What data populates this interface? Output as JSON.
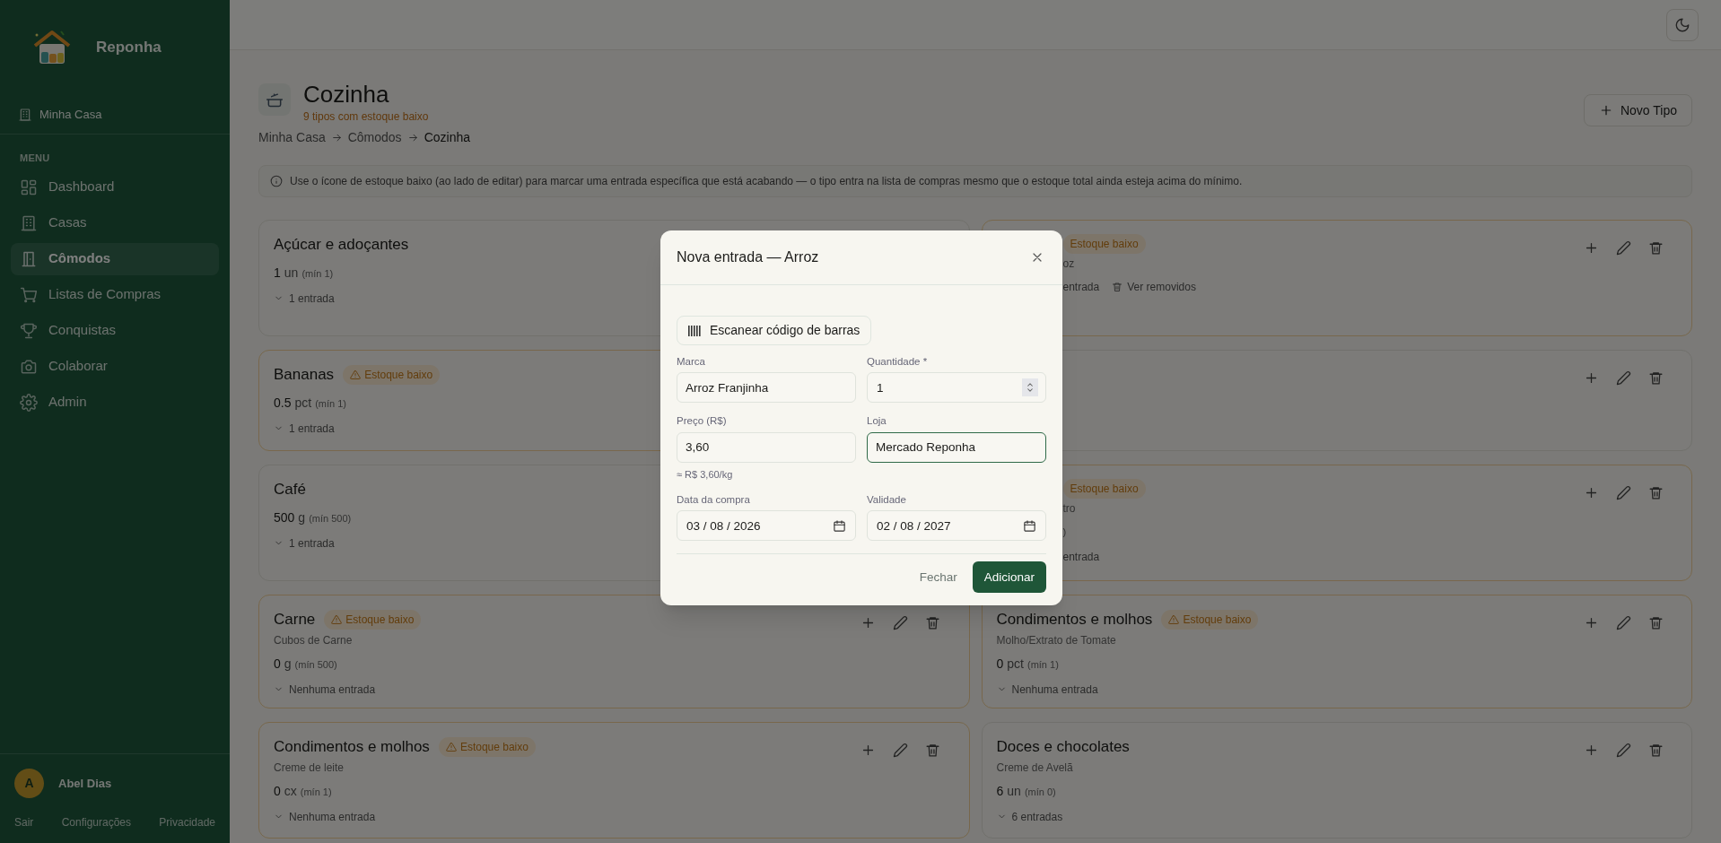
{
  "sidebar": {
    "brand": "Reponha",
    "house": "Minha Casa",
    "section": "MENU",
    "items": [
      {
        "label": "Dashboard",
        "selected": false
      },
      {
        "label": "Casas",
        "selected": false
      },
      {
        "label": "Cômodos",
        "selected": true
      },
      {
        "label": "Listas de Compras",
        "selected": false
      },
      {
        "label": "Conquistas",
        "selected": false
      },
      {
        "label": "Colaborar",
        "selected": false
      },
      {
        "label": "Admin",
        "selected": false
      }
    ],
    "user": {
      "initial": "A",
      "name": "Abel Dias"
    },
    "footer_links": [
      "Sair",
      "Configurações",
      "Privacidade"
    ]
  },
  "page": {
    "title": "Cozinha",
    "subtitle": "9 tipos com estoque baixo",
    "breadcrumb": [
      "Minha Casa",
      "Cômodos",
      "Cozinha"
    ],
    "new_button": "Novo Tipo",
    "notice": "Use o ícone de estoque baixo (ao lado de editar) para marcar uma entrada específica que está acabando — o tipo entra na lista de compras mesmo que o estoque total ainda esteja acima do mínimo."
  },
  "cards": [
    {
      "kind": "covered_right",
      "name": "Açúcar e adoçantes",
      "low_stock": false,
      "amount": "1",
      "unit": "un",
      "min": "(mín 1)",
      "entries": "1 entrada"
    },
    {
      "kind": "covered_left",
      "low_stock": true,
      "badge": "Estoque baixo",
      "subtitle": "oz",
      "entries": "entrada",
      "removed_link": "Ver removidos"
    },
    {
      "kind": "covered_right",
      "name": "Bananas",
      "low_stock": true,
      "badge": "Estoque baixo",
      "amount": "0.5",
      "unit": "pct",
      "min": "(mín 1)",
      "entries": "1 entrada"
    },
    {
      "kind": "covered_left",
      "low_stock": false
    },
    {
      "kind": "covered_right",
      "name": "Café",
      "low_stock": false,
      "amount": "500",
      "unit": "g",
      "min": "(mín 500)",
      "entries": "1 entrada"
    },
    {
      "kind": "covered_left",
      "low_stock": true,
      "badge": "Estoque baixo",
      "subtitle": "tro",
      "min": ")",
      "entries": "entrada"
    },
    {
      "kind": "full",
      "name": "Carne",
      "low_stock": true,
      "badge": "Estoque baixo",
      "subtitle": "Cubos de Carne",
      "amount": "0",
      "unit": "g",
      "min": "(mín 500)",
      "entries": "Nenhuma entrada"
    },
    {
      "kind": "full",
      "name": "Condimentos e molhos",
      "low_stock": true,
      "badge": "Estoque baixo",
      "subtitle": "Molho/Extrato de Tomate",
      "amount": "0",
      "unit": "pct",
      "min": "(mín 1)",
      "entries": "Nenhuma entrada"
    },
    {
      "kind": "full",
      "name": "Condimentos e molhos",
      "low_stock": true,
      "badge": "Estoque baixo",
      "subtitle": "Creme de leite",
      "amount": "0",
      "unit": "cx",
      "min": "(mín 1)",
      "entries": "Nenhuma entrada"
    },
    {
      "kind": "full",
      "name": "Doces e chocolates",
      "low_stock": false,
      "subtitle": "Creme de Avelã",
      "amount": "6",
      "unit": "un",
      "min": "(mín 0)",
      "entries": "6 entradas"
    }
  ],
  "dialog": {
    "title": "Nova entrada — Arroz",
    "scan_button": "Escanear código de barras",
    "fields": [
      {
        "kind": "text",
        "label": "Marca",
        "value": "Arroz Franjinha",
        "focused": false
      },
      {
        "kind": "number",
        "label": "Quantidade *",
        "value": "1",
        "focused": false
      },
      {
        "kind": "text",
        "label": "Preço (R$)",
        "value": "3,60",
        "focused": false,
        "hint": "≈ R$ 3,60/kg"
      },
      {
        "kind": "text",
        "label": "Loja",
        "value": "Mercado Reponha",
        "focused": true
      },
      {
        "kind": "date",
        "label": "Data da compra",
        "value": "03 / 08 / 2026",
        "focused": false
      },
      {
        "kind": "date",
        "label": "Validade",
        "value": "02 / 08 / 2027",
        "focused": false
      }
    ],
    "cancel_button": "Fechar",
    "submit_button": "Adicionar"
  }
}
